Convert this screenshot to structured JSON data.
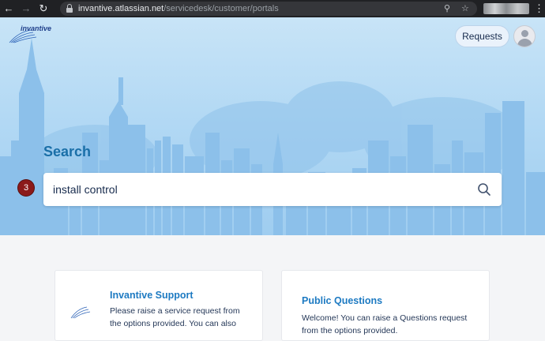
{
  "browser": {
    "url_host": "invantive.atlassian.net",
    "url_path": "/servicedesk/customer/portals"
  },
  "header": {
    "logo_text": "invantive",
    "requests_label": "Requests"
  },
  "search": {
    "title": "Search",
    "value": "install control",
    "step_badge": "3"
  },
  "portals": [
    {
      "title": "Invantive Support",
      "description": "Please raise a service request from the options provided. You can also",
      "logo_text": "invantive"
    },
    {
      "title": "Public Questions",
      "description": "Welcome! You can raise a Questions request from the options provided."
    }
  ],
  "colors": {
    "accent": "#1d7ac2",
    "badge": "#8b1a1a"
  }
}
